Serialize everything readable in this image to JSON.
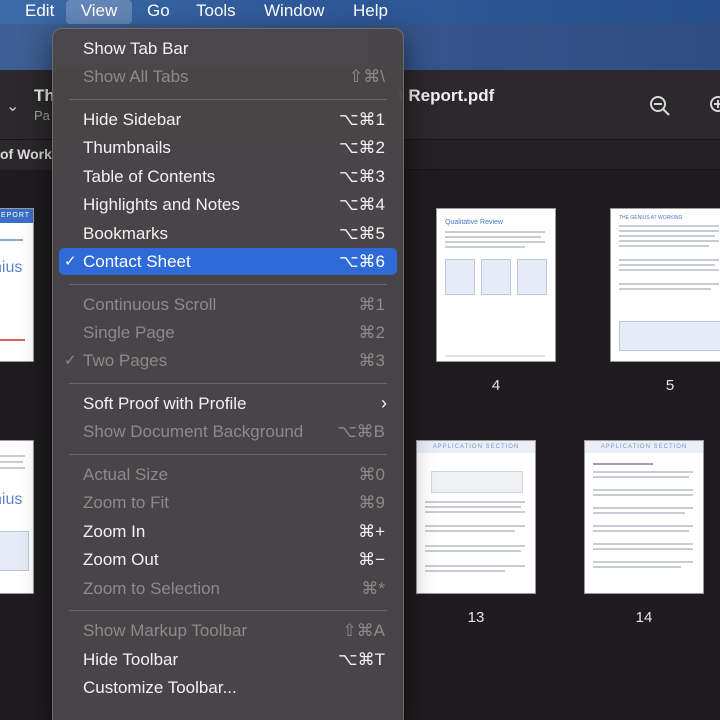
{
  "menubar": {
    "items": [
      {
        "label": "Edit",
        "active": false
      },
      {
        "label": "View",
        "active": true
      },
      {
        "label": "Go",
        "active": false
      },
      {
        "label": "Tools",
        "active": false
      },
      {
        "label": "Window",
        "active": false
      },
      {
        "label": "Help",
        "active": false
      }
    ]
  },
  "document": {
    "title_left": "Th",
    "title_right": "t Report.pdf",
    "subtitle": "Pa",
    "sidebar_label": "of Work"
  },
  "thumbnails": {
    "pages": [
      {
        "number": "4",
        "heading": "Qualitative Review"
      },
      {
        "number": "5",
        "heading": "THE GENIUS AT WORKING"
      },
      {
        "number": "13",
        "heading": "APPLICATION SECTION"
      },
      {
        "number": "14",
        "heading": "APPLICATION SECTION"
      }
    ],
    "left_cover_text": "REPORT",
    "left_cover_word": "nius"
  },
  "view_menu": {
    "groups": [
      [
        {
          "label": "Show Tab Bar",
          "shortcut": "",
          "enabled": true,
          "checked": false
        },
        {
          "label": "Show All Tabs",
          "shortcut": "⇧⌘\\",
          "enabled": false,
          "checked": false
        }
      ],
      [
        {
          "label": "Hide Sidebar",
          "shortcut": "⌥⌘1",
          "enabled": true,
          "checked": false
        },
        {
          "label": "Thumbnails",
          "shortcut": "⌥⌘2",
          "enabled": true,
          "checked": false
        },
        {
          "label": "Table of Contents",
          "shortcut": "⌥⌘3",
          "enabled": true,
          "checked": false
        },
        {
          "label": "Highlights and Notes",
          "shortcut": "⌥⌘4",
          "enabled": true,
          "checked": false
        },
        {
          "label": "Bookmarks",
          "shortcut": "⌥⌘5",
          "enabled": true,
          "checked": false
        },
        {
          "label": "Contact Sheet",
          "shortcut": "⌥⌘6",
          "enabled": true,
          "checked": true,
          "selected": true
        }
      ],
      [
        {
          "label": "Continuous Scroll",
          "shortcut": "⌘1",
          "enabled": false,
          "checked": false
        },
        {
          "label": "Single Page",
          "shortcut": "⌘2",
          "enabled": false,
          "checked": false
        },
        {
          "label": "Two Pages",
          "shortcut": "⌘3",
          "enabled": false,
          "checked": true
        }
      ],
      [
        {
          "label": "Soft Proof with Profile",
          "shortcut": "",
          "enabled": true,
          "checked": false,
          "submenu": true
        },
        {
          "label": "Show Document Background",
          "shortcut": "⌥⌘B",
          "enabled": false,
          "checked": false
        }
      ],
      [
        {
          "label": "Actual Size",
          "shortcut": "⌘0",
          "enabled": false,
          "checked": false
        },
        {
          "label": "Zoom to Fit",
          "shortcut": "⌘9",
          "enabled": false,
          "checked": false
        },
        {
          "label": "Zoom In",
          "shortcut": "⌘+",
          "enabled": true,
          "checked": false
        },
        {
          "label": "Zoom Out",
          "shortcut": "⌘−",
          "enabled": true,
          "checked": false
        },
        {
          "label": "Zoom to Selection",
          "shortcut": "⌘*",
          "enabled": false,
          "checked": false
        }
      ],
      [
        {
          "label": "Show Markup Toolbar",
          "shortcut": "⇧⌘A",
          "enabled": false,
          "checked": false
        },
        {
          "label": "Hide Toolbar",
          "shortcut": "⌥⌘T",
          "enabled": true,
          "checked": false
        },
        {
          "label": "Customize Toolbar...",
          "shortcut": "",
          "enabled": true,
          "checked": false
        }
      ]
    ],
    "check_glyph": "✓",
    "submenu_glyph": "›"
  },
  "icons": {
    "zoom_out": "zoom-out-icon",
    "zoom_in": "zoom-in-icon",
    "chevron": "chevron-down-icon"
  },
  "colors": {
    "menu_selection": "#2f6bd8",
    "menubar": "#2f5a99"
  }
}
